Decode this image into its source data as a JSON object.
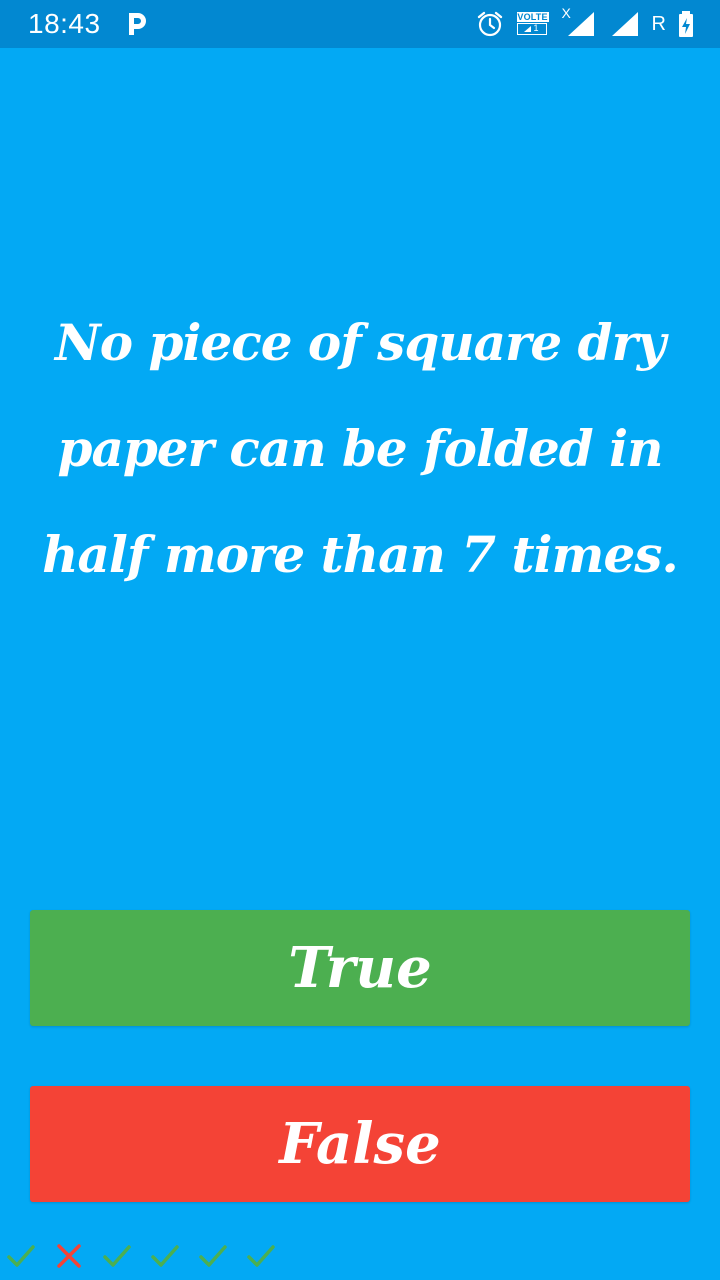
{
  "status_bar": {
    "time": "18:43",
    "notification_icon": "p-app-icon",
    "alarm_icon": "alarm-clock-icon",
    "volte_label": "VOLTE",
    "volte_sim": "1",
    "signal_sim1_icon": "signal-icon",
    "signal_sim1_badge": "X",
    "signal_sim2_icon": "signal-icon",
    "roaming_label": "R",
    "battery_icon": "battery-charging-icon",
    "bg_color": "#0288D1"
  },
  "quiz": {
    "question": "No piece of square dry paper can be folded in half more than 7 times.",
    "true_label": "True",
    "false_label": "False",
    "true_color": "#4CAF50",
    "false_color": "#F44336",
    "background_color": "#03A9F4"
  },
  "history": {
    "results": [
      "correct",
      "wrong",
      "correct",
      "correct",
      "correct",
      "correct"
    ],
    "correct_icon": "check-icon",
    "wrong_icon": "cross-icon",
    "correct_color": "#4CAF50",
    "wrong_color": "#F44336"
  }
}
